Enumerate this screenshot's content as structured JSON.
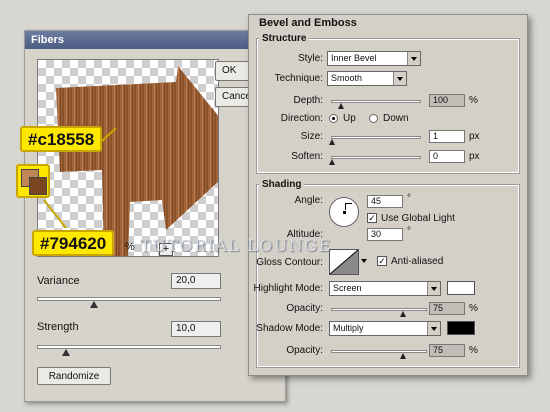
{
  "fibers": {
    "title": "Fibers",
    "buttons": [
      "OK",
      "Cancel"
    ],
    "zoom": "%",
    "zoom_in": "+",
    "variance_label": "Variance",
    "variance_value": "20,0",
    "variance_level": 0.3,
    "strength_label": "Strength",
    "strength_value": "10,0",
    "strength_level": 0.15,
    "randomize_label": "Randomize"
  },
  "callouts": {
    "top_color": "#c18558",
    "bottom_color": "#794620"
  },
  "watermark": "TUTORIAL LOUNGE",
  "bevel": {
    "title": "Bevel and Emboss",
    "structure": {
      "title": "Structure",
      "style_label": "Style:",
      "style_value": "Inner Bevel",
      "technique_label": "Technique:",
      "technique_value": "Smooth",
      "depth_label": "Depth:",
      "depth_value": "100",
      "depth_unit": "%",
      "depth_level": 0.1,
      "direction_label": "Direction:",
      "direction_up": "Up",
      "direction_down": "Down",
      "size_label": "Size:",
      "size_value": "1",
      "size_unit": "px",
      "size_level": 0.0,
      "soften_label": "Soften:",
      "soften_value": "0",
      "soften_unit": "px",
      "soften_level": 0.0
    },
    "shading": {
      "title": "Shading",
      "angle_label": "Angle:",
      "angle_value": "45",
      "angle_unit": "°",
      "use_global_light": "Use Global Light",
      "altitude_label": "Altitude:",
      "altitude_value": "30",
      "altitude_unit": "°",
      "gloss_contour_label": "Gloss Contour:",
      "anti_aliased": "Anti-aliased",
      "highlight_mode_label": "Highlight Mode:",
      "highlight_mode_value": "Screen",
      "highlight_color": "#ffffff",
      "highlight_opacity_label": "Opacity:",
      "highlight_opacity_value": "75",
      "highlight_opacity_unit": "%",
      "highlight_opacity_level": 0.75,
      "shadow_mode_label": "Shadow Mode:",
      "shadow_mode_value": "Multiply",
      "shadow_color": "#000000",
      "shadow_opacity_label": "Opacity:",
      "shadow_opacity_value": "75",
      "shadow_opacity_unit": "%",
      "shadow_opacity_level": 0.75
    }
  },
  "colors": {
    "callout_fill": "#ffe800",
    "wood_light": "#c18558",
    "wood_dark": "#794620"
  }
}
